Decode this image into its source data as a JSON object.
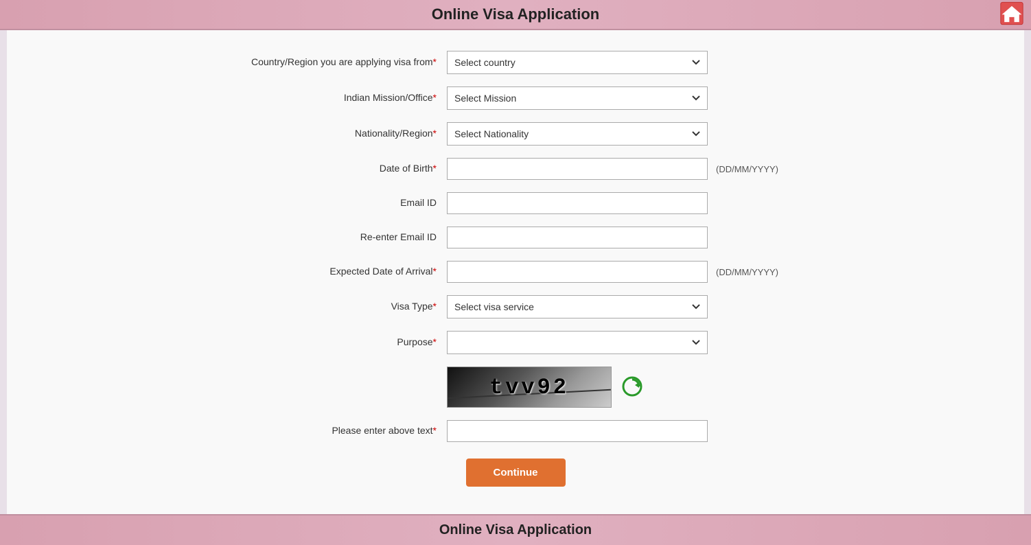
{
  "header": {
    "title": "Online Visa Application",
    "home_icon_label": "Home"
  },
  "footer": {
    "title": "Online Visa Application"
  },
  "form": {
    "fields": [
      {
        "id": "country-region",
        "label": "Country/Region you are applying visa from",
        "required": true,
        "type": "select",
        "placeholder": "Select country",
        "hint": ""
      },
      {
        "id": "indian-mission",
        "label": "Indian Mission/Office",
        "required": true,
        "type": "select",
        "placeholder": "Select Mission",
        "hint": ""
      },
      {
        "id": "nationality",
        "label": "Nationality/Region",
        "required": true,
        "type": "select",
        "placeholder": "Select Nationality",
        "hint": ""
      },
      {
        "id": "dob",
        "label": "Date of Birth",
        "required": true,
        "type": "text",
        "placeholder": "",
        "hint": "(DD/MM/YYYY)"
      },
      {
        "id": "email",
        "label": "Email ID",
        "required": false,
        "type": "text",
        "placeholder": "",
        "hint": ""
      },
      {
        "id": "re-email",
        "label": "Re-enter Email ID",
        "required": false,
        "type": "text",
        "placeholder": "",
        "hint": ""
      },
      {
        "id": "arrival-date",
        "label": "Expected Date of Arrival",
        "required": true,
        "type": "text",
        "placeholder": "",
        "hint": "(DD/MM/YYYY)"
      },
      {
        "id": "visa-type",
        "label": "Visa Type",
        "required": true,
        "type": "select",
        "placeholder": "Select visa service",
        "hint": ""
      },
      {
        "id": "purpose",
        "label": "Purpose",
        "required": true,
        "type": "select",
        "placeholder": "",
        "hint": ""
      }
    ],
    "captcha": {
      "text": "tvv92",
      "refresh_label": "Refresh captcha"
    },
    "captcha_input": {
      "label": "Please enter above text",
      "required": true
    },
    "continue_button": "Continue"
  }
}
